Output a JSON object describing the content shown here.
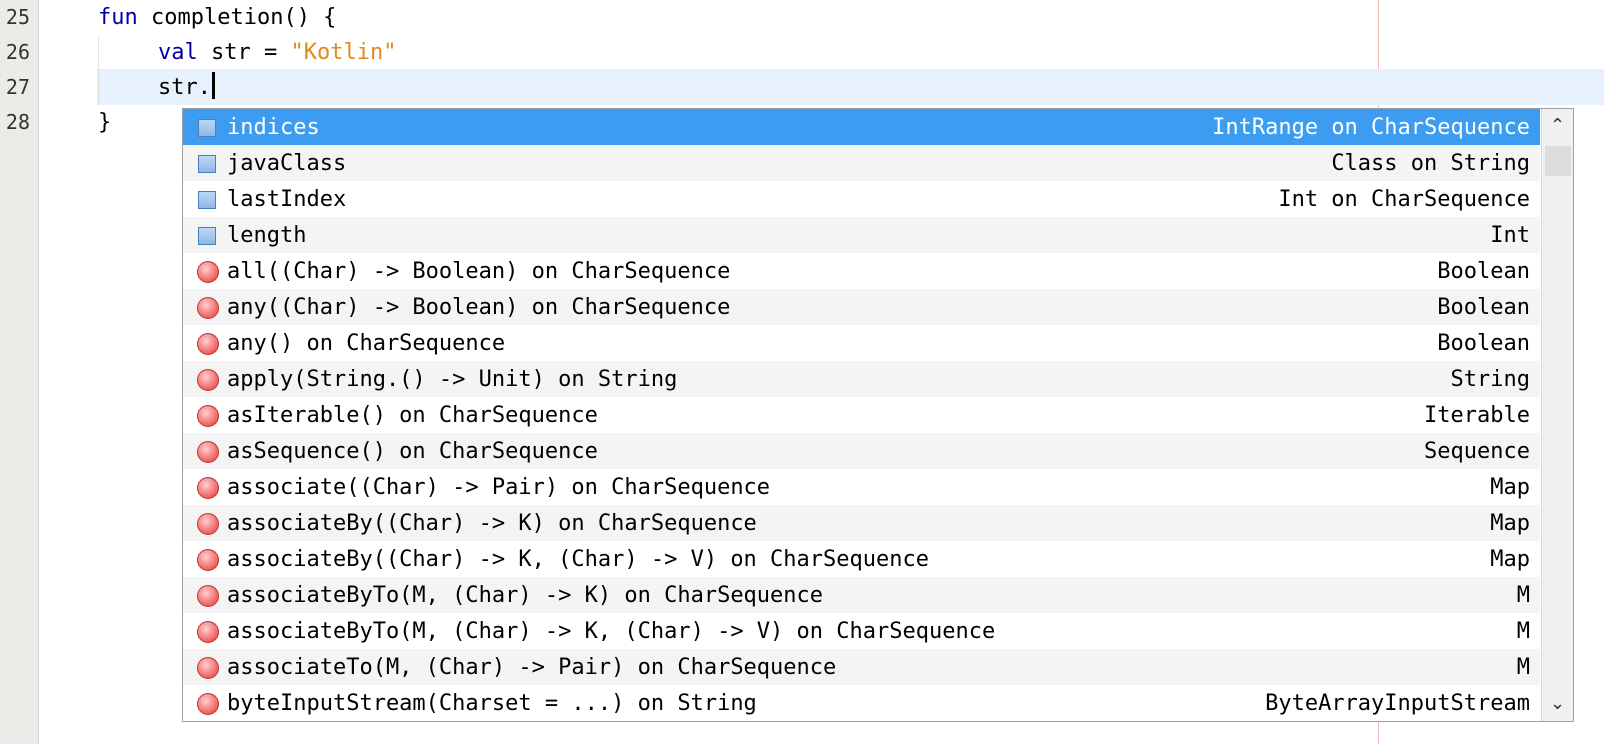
{
  "editor": {
    "line_numbers": [
      "25",
      "26",
      "27",
      "28"
    ],
    "lines": {
      "l25": {
        "kw": "fun",
        "rest": "completion() {"
      },
      "l26": {
        "kw": "val",
        "rest": "str = ",
        "str": "\"Kotlin\""
      },
      "l27": {
        "text": "str."
      },
      "l28": {
        "text": "}"
      }
    }
  },
  "completion": {
    "selected_index": 0,
    "items": [
      {
        "icon": "property-icon",
        "label": "indices",
        "type": "IntRange on CharSequence"
      },
      {
        "icon": "property-icon",
        "label": "javaClass",
        "type": "Class on String"
      },
      {
        "icon": "property-icon",
        "label": "lastIndex",
        "type": "Int on CharSequence"
      },
      {
        "icon": "property-icon",
        "label": "length",
        "type": "Int"
      },
      {
        "icon": "function-icon",
        "label": "all((Char) -> Boolean) on CharSequence",
        "type": "Boolean"
      },
      {
        "icon": "function-icon",
        "label": "any((Char) -> Boolean) on CharSequence",
        "type": "Boolean"
      },
      {
        "icon": "function-icon",
        "label": "any() on CharSequence",
        "type": "Boolean"
      },
      {
        "icon": "function-icon",
        "label": "apply(String.() -> Unit) on String",
        "type": "String"
      },
      {
        "icon": "function-icon",
        "label": "asIterable() on CharSequence",
        "type": "Iterable"
      },
      {
        "icon": "function-icon",
        "label": "asSequence() on CharSequence",
        "type": "Sequence"
      },
      {
        "icon": "function-icon",
        "label": "associate((Char) -> Pair) on CharSequence",
        "type": "Map"
      },
      {
        "icon": "function-icon",
        "label": "associateBy((Char) -> K) on CharSequence",
        "type": "Map"
      },
      {
        "icon": "function-icon",
        "label": "associateBy((Char) -> K, (Char) -> V) on CharSequence",
        "type": "Map"
      },
      {
        "icon": "function-icon",
        "label": "associateByTo(M, (Char) -> K) on CharSequence",
        "type": "M"
      },
      {
        "icon": "function-icon",
        "label": "associateByTo(M, (Char) -> K, (Char) -> V) on CharSequence",
        "type": "M"
      },
      {
        "icon": "function-icon",
        "label": "associateTo(M, (Char) -> Pair) on CharSequence",
        "type": "M"
      },
      {
        "icon": "function-icon",
        "label": "byteInputStream(Charset = ...) on String",
        "type": "ByteArrayInputStream"
      }
    ],
    "scroll_up_icon": "chevron-up-icon",
    "scroll_down_icon": "chevron-down-icon"
  },
  "colors": {
    "keyword": "#0000a0",
    "string": "#e08a20",
    "selection": "#3c9cf1",
    "current_line": "#e8f2fe"
  }
}
